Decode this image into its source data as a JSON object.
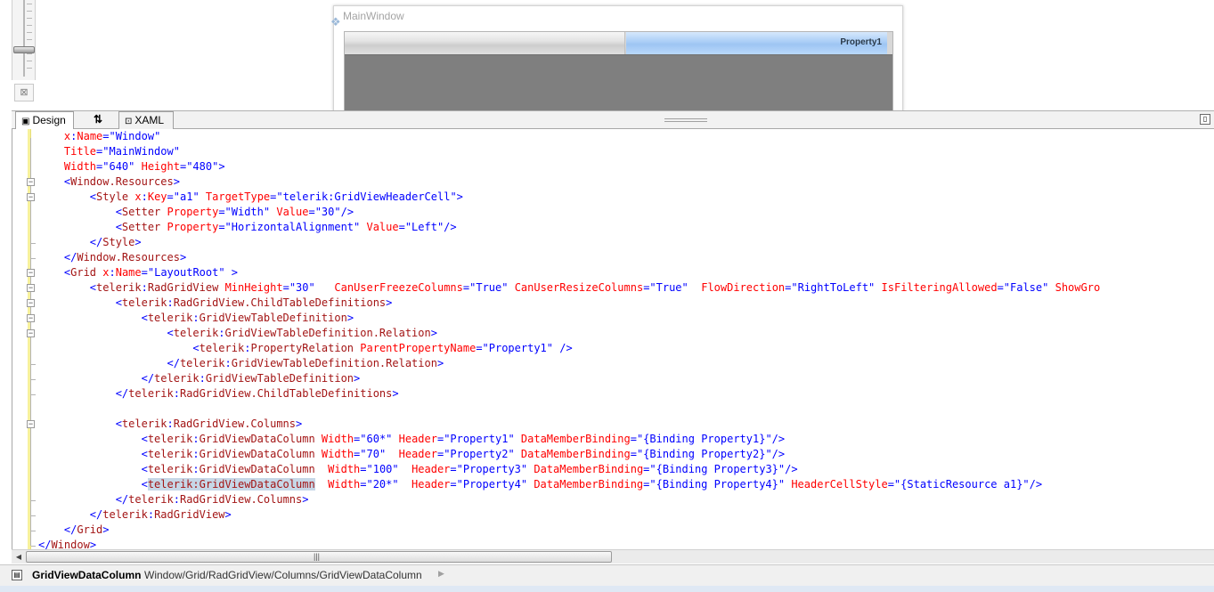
{
  "design_surface": {
    "window_title": "MainWindow",
    "grid_header_column": "Property1",
    "fit_icon": "fit-to-screen-icon"
  },
  "tabs": {
    "design_label": "Design",
    "swap_glyph": "⇅",
    "xaml_label": "XAML"
  },
  "status": {
    "element": "GridViewDataColumn",
    "path": "Window/Grid/RadGridView/Columns/GridViewDataColumn"
  },
  "code_lines": [
    [
      [
        "    ",
        "v"
      ],
      [
        "x",
        "at"
      ],
      [
        ":",
        "v"
      ],
      [
        "Name",
        "at"
      ],
      [
        "=\"Window\"",
        "v"
      ]
    ],
    [
      [
        "    ",
        "v"
      ],
      [
        "Title",
        "at"
      ],
      [
        "=\"MainWindow\"",
        "v"
      ]
    ],
    [
      [
        "    ",
        "v"
      ],
      [
        "Width",
        "at"
      ],
      [
        "=\"640\" ",
        "v"
      ],
      [
        "Height",
        "at"
      ],
      [
        "=\"480\">",
        "v"
      ]
    ],
    [
      [
        "    <",
        "v"
      ],
      [
        "Window.Resources",
        "el"
      ],
      [
        ">",
        "v"
      ]
    ],
    [
      [
        "        <",
        "v"
      ],
      [
        "Style",
        "el"
      ],
      [
        " ",
        "v"
      ],
      [
        "x",
        "at"
      ],
      [
        ":",
        "v"
      ],
      [
        "Key",
        "at"
      ],
      [
        "=\"a1\" ",
        "v"
      ],
      [
        "TargetType",
        "at"
      ],
      [
        "=\"telerik:GridViewHeaderCell\">",
        "v"
      ]
    ],
    [
      [
        "            <",
        "v"
      ],
      [
        "Setter",
        "el"
      ],
      [
        " ",
        "v"
      ],
      [
        "Property",
        "at"
      ],
      [
        "=\"Width\" ",
        "v"
      ],
      [
        "Value",
        "at"
      ],
      [
        "=\"30\"/>",
        "v"
      ]
    ],
    [
      [
        "            <",
        "v"
      ],
      [
        "Setter",
        "el"
      ],
      [
        " ",
        "v"
      ],
      [
        "Property",
        "at"
      ],
      [
        "=\"HorizontalAlignment\" ",
        "v"
      ],
      [
        "Value",
        "at"
      ],
      [
        "=\"Left\"/>",
        "v"
      ]
    ],
    [
      [
        "        </",
        "v"
      ],
      [
        "Style",
        "el"
      ],
      [
        ">",
        "v"
      ]
    ],
    [
      [
        "    </",
        "v"
      ],
      [
        "Window.Resources",
        "el"
      ],
      [
        ">",
        "v"
      ]
    ],
    [
      [
        "    <",
        "v"
      ],
      [
        "Grid",
        "el"
      ],
      [
        " ",
        "v"
      ],
      [
        "x",
        "at"
      ],
      [
        ":",
        "v"
      ],
      [
        "Name",
        "at"
      ],
      [
        "=\"LayoutRoot\" >",
        "v"
      ]
    ],
    [
      [
        "        <",
        "v"
      ],
      [
        "telerik",
        "el"
      ],
      [
        ":",
        "v"
      ],
      [
        "RadGridView",
        "el"
      ],
      [
        " ",
        "v"
      ],
      [
        "MinHeight",
        "at"
      ],
      [
        "=\"30\"   ",
        "v"
      ],
      [
        "CanUserFreezeColumns",
        "at"
      ],
      [
        "=\"True\" ",
        "v"
      ],
      [
        "CanUserResizeColumns",
        "at"
      ],
      [
        "=\"True\"  ",
        "v"
      ],
      [
        "FlowDirection",
        "at"
      ],
      [
        "=\"RightToLeft\" ",
        "v"
      ],
      [
        "IsFilteringAllowed",
        "at"
      ],
      [
        "=\"False\" ",
        "v"
      ],
      [
        "ShowGro",
        "at"
      ]
    ],
    [
      [
        "            <",
        "v"
      ],
      [
        "telerik",
        "el"
      ],
      [
        ":",
        "v"
      ],
      [
        "RadGridView.ChildTableDefinitions",
        "el"
      ],
      [
        ">",
        "v"
      ]
    ],
    [
      [
        "                <",
        "v"
      ],
      [
        "telerik",
        "el"
      ],
      [
        ":",
        "v"
      ],
      [
        "GridViewTableDefinition",
        "el"
      ],
      [
        ">",
        "v"
      ]
    ],
    [
      [
        "                    <",
        "v"
      ],
      [
        "telerik",
        "el"
      ],
      [
        ":",
        "v"
      ],
      [
        "GridViewTableDefinition.Relation",
        "el"
      ],
      [
        ">",
        "v"
      ]
    ],
    [
      [
        "                        <",
        "v"
      ],
      [
        "telerik",
        "el"
      ],
      [
        ":",
        "v"
      ],
      [
        "PropertyRelation",
        "el"
      ],
      [
        " ",
        "v"
      ],
      [
        "ParentPropertyName",
        "at"
      ],
      [
        "=\"Property1\" />",
        "v"
      ]
    ],
    [
      [
        "                    </",
        "v"
      ],
      [
        "telerik",
        "el"
      ],
      [
        ":",
        "v"
      ],
      [
        "GridViewTableDefinition.Relation",
        "el"
      ],
      [
        ">",
        "v"
      ]
    ],
    [
      [
        "                </",
        "v"
      ],
      [
        "telerik",
        "el"
      ],
      [
        ":",
        "v"
      ],
      [
        "GridViewTableDefinition",
        "el"
      ],
      [
        ">",
        "v"
      ]
    ],
    [
      [
        "            </",
        "v"
      ],
      [
        "telerik",
        "el"
      ],
      [
        ":",
        "v"
      ],
      [
        "RadGridView.ChildTableDefinitions",
        "el"
      ],
      [
        ">",
        "v"
      ]
    ],
    [],
    [
      [
        "            <",
        "v"
      ],
      [
        "telerik",
        "el"
      ],
      [
        ":",
        "v"
      ],
      [
        "RadGridView.Columns",
        "el"
      ],
      [
        ">",
        "v"
      ]
    ],
    [
      [
        "                <",
        "v"
      ],
      [
        "telerik",
        "el"
      ],
      [
        ":",
        "v"
      ],
      [
        "GridViewDataColumn",
        "el"
      ],
      [
        " ",
        "v"
      ],
      [
        "Width",
        "at"
      ],
      [
        "=\"60*\" ",
        "v"
      ],
      [
        "Header",
        "at"
      ],
      [
        "=\"Property1\" ",
        "v"
      ],
      [
        "DataMemberBinding",
        "at"
      ],
      [
        "=\"{Binding Property1}\"/>",
        "v"
      ]
    ],
    [
      [
        "                <",
        "v"
      ],
      [
        "telerik",
        "el"
      ],
      [
        ":",
        "v"
      ],
      [
        "GridViewDataColumn",
        "el"
      ],
      [
        " ",
        "v"
      ],
      [
        "Width",
        "at"
      ],
      [
        "=\"70\"  ",
        "v"
      ],
      [
        "Header",
        "at"
      ],
      [
        "=\"Property2\" ",
        "v"
      ],
      [
        "DataMemberBinding",
        "at"
      ],
      [
        "=\"{Binding Property2}\"/>",
        "v"
      ]
    ],
    [
      [
        "                <",
        "v"
      ],
      [
        "telerik",
        "el"
      ],
      [
        ":",
        "v"
      ],
      [
        "GridViewDataColumn",
        "el"
      ],
      [
        "  ",
        "v"
      ],
      [
        "Width",
        "at"
      ],
      [
        "=\"100\"  ",
        "v"
      ],
      [
        "Header",
        "at"
      ],
      [
        "=\"Property3\" ",
        "v"
      ],
      [
        "DataMemberBinding",
        "at"
      ],
      [
        "=\"{Binding Property3}\"/>",
        "v"
      ]
    ],
    [
      [
        "                <",
        "v"
      ],
      [
        "telerik:GridViewDataColumn",
        "sel"
      ],
      [
        "  ",
        "v"
      ],
      [
        "Width",
        "at"
      ],
      [
        "=\"20*\"  ",
        "v"
      ],
      [
        "Header",
        "at"
      ],
      [
        "=\"Property4\" ",
        "v"
      ],
      [
        "DataMemberBinding",
        "at"
      ],
      [
        "=\"{Binding Property4}\" ",
        "v"
      ],
      [
        "HeaderCellStyle",
        "at"
      ],
      [
        "=\"{StaticResource a1}\"/>",
        "v"
      ]
    ],
    [
      [
        "            </",
        "v"
      ],
      [
        "telerik",
        "el"
      ],
      [
        ":",
        "v"
      ],
      [
        "RadGridView.Columns",
        "el"
      ],
      [
        ">",
        "v"
      ]
    ],
    [
      [
        "        </",
        "v"
      ],
      [
        "telerik",
        "el"
      ],
      [
        ":",
        "v"
      ],
      [
        "RadGridView",
        "el"
      ],
      [
        ">",
        "v"
      ]
    ],
    [
      [
        "    </",
        "v"
      ],
      [
        "Grid",
        "el"
      ],
      [
        ">",
        "v"
      ]
    ],
    [
      [
        "</",
        "v"
      ],
      [
        "Window",
        "el"
      ],
      [
        ">",
        "v"
      ]
    ]
  ],
  "fold_markers": [
    {
      "line": 3,
      "kind": "open"
    },
    {
      "line": 4,
      "kind": "open"
    },
    {
      "line": 7,
      "kind": "end"
    },
    {
      "line": 8,
      "kind": "end"
    },
    {
      "line": 9,
      "kind": "open"
    },
    {
      "line": 10,
      "kind": "open"
    },
    {
      "line": 11,
      "kind": "open"
    },
    {
      "line": 12,
      "kind": "open"
    },
    {
      "line": 13,
      "kind": "open"
    },
    {
      "line": 15,
      "kind": "end"
    },
    {
      "line": 16,
      "kind": "end"
    },
    {
      "line": 17,
      "kind": "end"
    },
    {
      "line": 19,
      "kind": "open"
    },
    {
      "line": 24,
      "kind": "end"
    },
    {
      "line": 25,
      "kind": "end"
    },
    {
      "line": 26,
      "kind": "end"
    },
    {
      "line": 27,
      "kind": "end"
    }
  ]
}
